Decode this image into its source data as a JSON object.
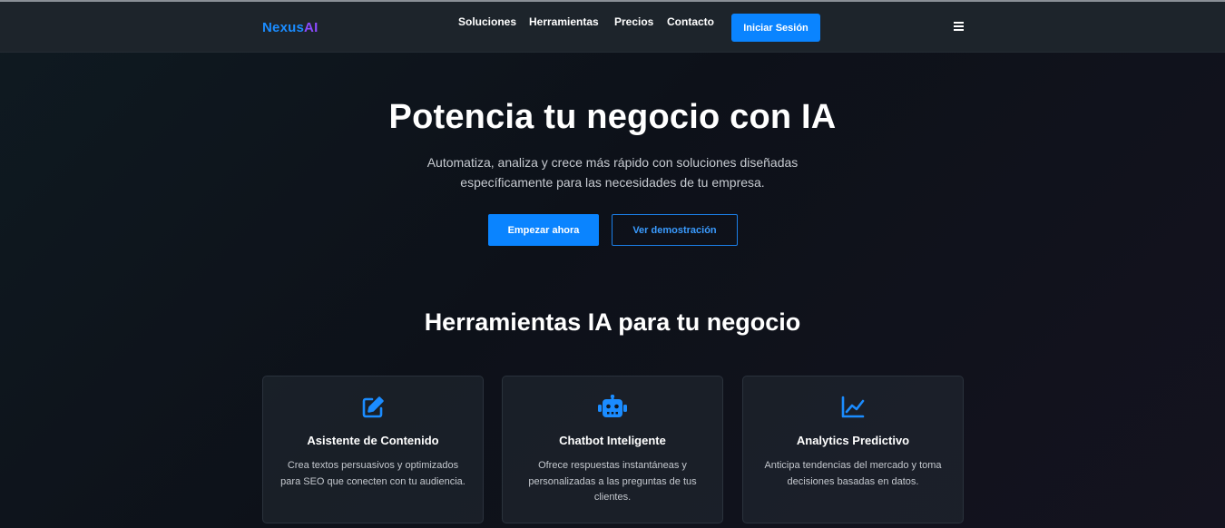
{
  "header": {
    "logo_part1": "Nexus",
    "logo_part2": "AI",
    "nav": [
      "Soluciones",
      "Herramientas",
      "Precios",
      "Contacto"
    ],
    "login_label": "Iniciar Sesión",
    "menu_icon": "hamburger-menu-icon"
  },
  "hero": {
    "title": "Potencia tu negocio con IA",
    "subtitle": "Automatiza, analiza y crece más rápido con soluciones diseñadas específicamente para las necesidades de tu empresa.",
    "primary_label": "Empezar ahora",
    "secondary_label": "Ver demostración"
  },
  "tools": {
    "title": "Herramientas IA para tu negocio",
    "cards": [
      {
        "icon": "edit-icon",
        "title": "Asistente de Contenido",
        "desc": "Crea textos persuasivos y optimizados para SEO que conecten con tu audiencia."
      },
      {
        "icon": "robot-icon",
        "title": "Chatbot Inteligente",
        "desc": "Ofrece respuestas instantáneas y personalizadas a las preguntas de tus clientes."
      },
      {
        "icon": "chart-line-icon",
        "title": "Analytics Predictivo",
        "desc": "Anticipa tendencias del mercado y toma decisiones basadas en datos."
      }
    ]
  },
  "colors": {
    "accent": "#0a84ff",
    "logo_ai": "#8b4bff",
    "header_bg": "#1d242b",
    "page_bg": "#0d1119"
  }
}
